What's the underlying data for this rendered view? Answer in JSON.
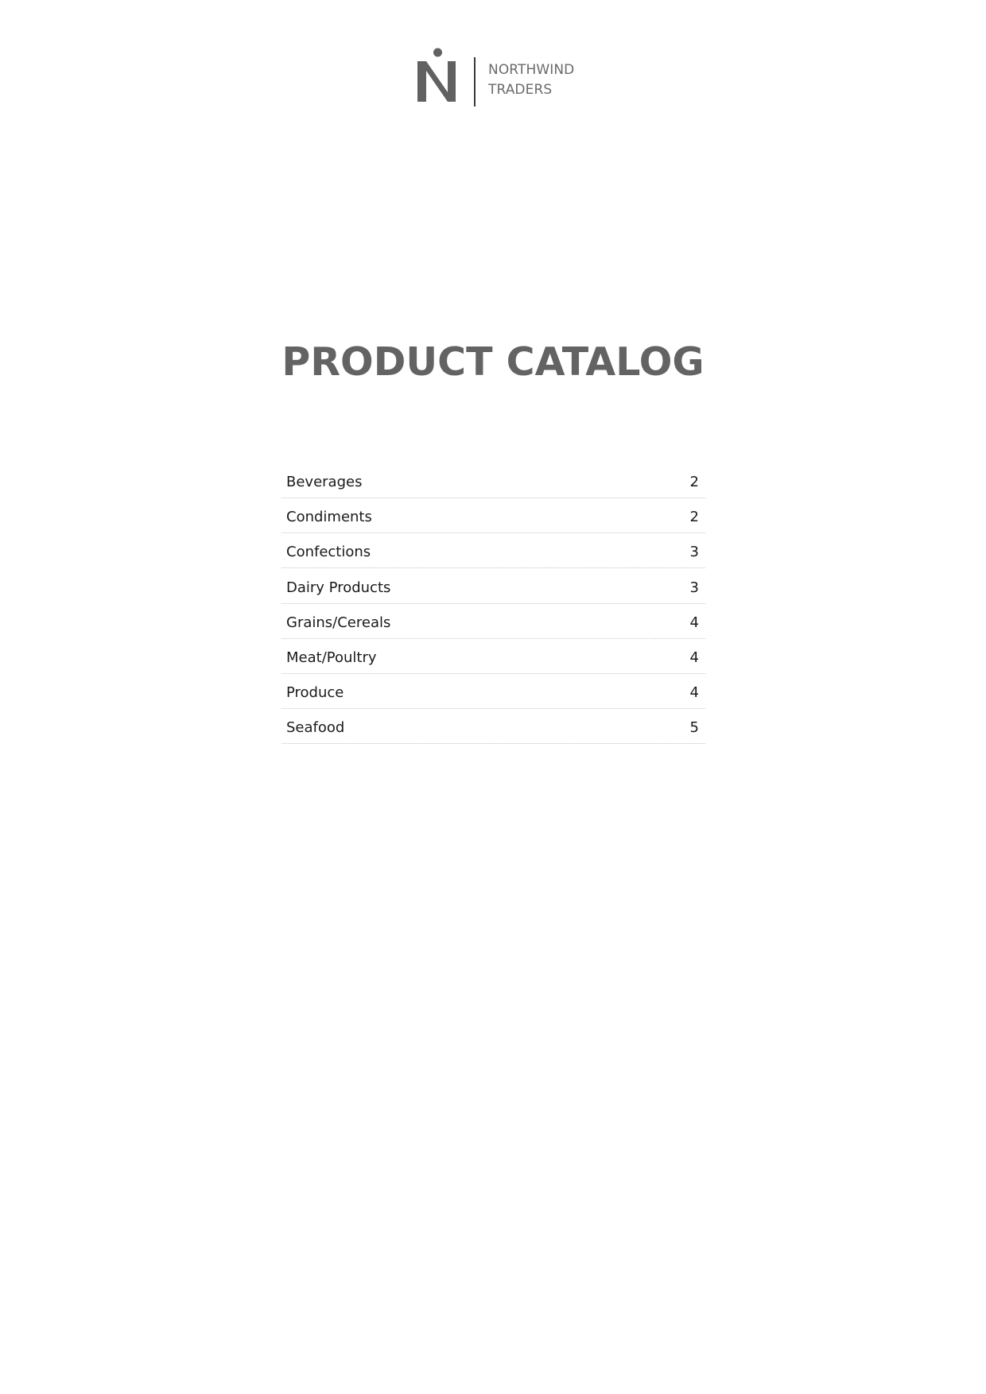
{
  "logo": {
    "brand_line1": "NORTHWIND",
    "brand_line2": "TRADERS",
    "mark_color": "#616161",
    "text_color": "#6a6a6a"
  },
  "title": "PRODUCT CATALOG",
  "toc": {
    "entries": [
      {
        "label": "Beverages",
        "page": "2"
      },
      {
        "label": "Condiments",
        "page": "2"
      },
      {
        "label": "Confections",
        "page": "3"
      },
      {
        "label": "Dairy Products",
        "page": "3"
      },
      {
        "label": "Grains/Cereals",
        "page": "4"
      },
      {
        "label": "Meat/Poultry",
        "page": "4"
      },
      {
        "label": "Produce",
        "page": "4"
      },
      {
        "label": "Seafood",
        "page": "5"
      }
    ]
  },
  "colors": {
    "title": "#636363",
    "leader_dots": "#c4c4c4",
    "body_text": "#1a1a1a"
  }
}
